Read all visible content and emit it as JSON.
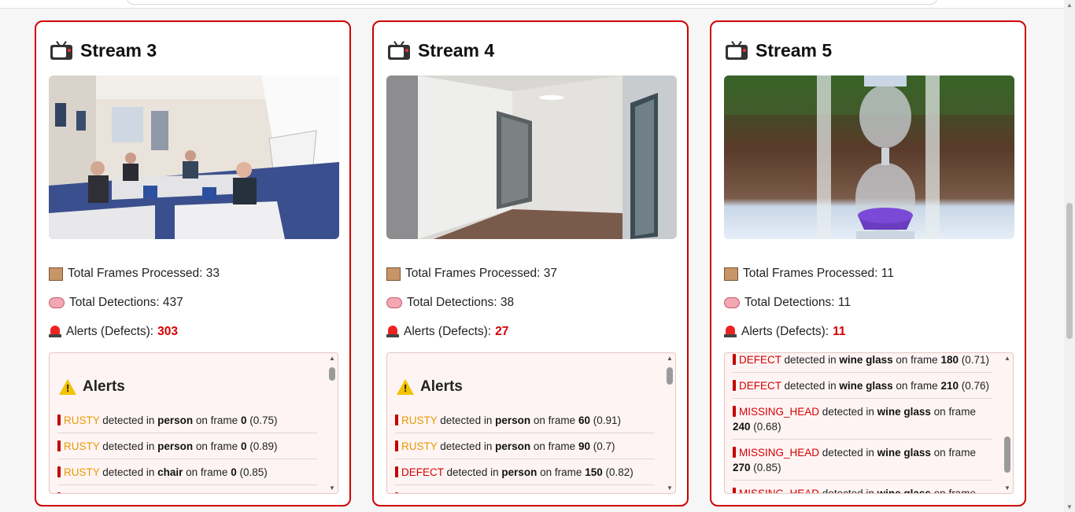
{
  "colors": {
    "accent_border": "#d00000",
    "alert_bg": "#fff4f4",
    "rusty": "#e69a00",
    "defect": "#d40000"
  },
  "streams": [
    {
      "title": "Stream 3",
      "frames_label": "Total Frames Processed:",
      "frames": "33",
      "detections_label": "Total Detections:",
      "detections": "437",
      "alerts_label": "Alerts (Defects):",
      "alerts_count": "303",
      "alerts_title": "Alerts",
      "alerts": [
        {
          "label": "RUSTY",
          "mid": "detected in",
          "object": "person",
          "frame_text": "on frame",
          "frame": "0",
          "conf": "(0.75)"
        },
        {
          "label": "RUSTY",
          "mid": "detected in",
          "object": "person",
          "frame_text": "on frame",
          "frame": "0",
          "conf": "(0.89)"
        },
        {
          "label": "RUSTY",
          "mid": "detected in",
          "object": "chair",
          "frame_text": "on frame",
          "frame": "0",
          "conf": "(0.85)"
        }
      ]
    },
    {
      "title": "Stream 4",
      "frames_label": "Total Frames Processed:",
      "frames": "37",
      "detections_label": "Total Detections:",
      "detections": "38",
      "alerts_label": "Alerts (Defects):",
      "alerts_count": "27",
      "alerts_title": "Alerts",
      "alerts": [
        {
          "label": "RUSTY",
          "mid": "detected in",
          "object": "person",
          "frame_text": "on frame",
          "frame": "60",
          "conf": "(0.91)"
        },
        {
          "label": "RUSTY",
          "mid": "detected in",
          "object": "person",
          "frame_text": "on frame",
          "frame": "90",
          "conf": "(0.7)"
        },
        {
          "label": "DEFECT",
          "mid": "detected in",
          "object": "person",
          "frame_text": "on frame",
          "frame": "150",
          "conf": "(0.82)"
        }
      ]
    },
    {
      "title": "Stream 5",
      "frames_label": "Total Frames Processed:",
      "frames": "11",
      "detections_label": "Total Detections:",
      "detections": "11",
      "alerts_label": "Alerts (Defects):",
      "alerts_count": "11",
      "alerts": [
        {
          "label": "DEFECT",
          "mid": "detected in",
          "object": "wine glass",
          "frame_text": "on frame",
          "frame": "180",
          "conf": "(0.71)"
        },
        {
          "label": "DEFECT",
          "mid": "detected in",
          "object": "wine glass",
          "frame_text": "on frame",
          "frame": "210",
          "conf": "(0.76)"
        },
        {
          "label": "MISSING_HEAD",
          "mid": "detected in",
          "object": "wine glass",
          "frame_text": "on frame",
          "frame": "240",
          "conf": "(0.68)"
        },
        {
          "label": "MISSING_HEAD",
          "mid": "detected in",
          "object": "wine glass",
          "frame_text": "on frame",
          "frame": "270",
          "conf": "(0.85)"
        },
        {
          "label": "MISSING_HEAD",
          "mid": "detected in",
          "object": "wine glass",
          "frame_text": "on frame",
          "frame": "",
          "conf": ""
        }
      ]
    }
  ]
}
